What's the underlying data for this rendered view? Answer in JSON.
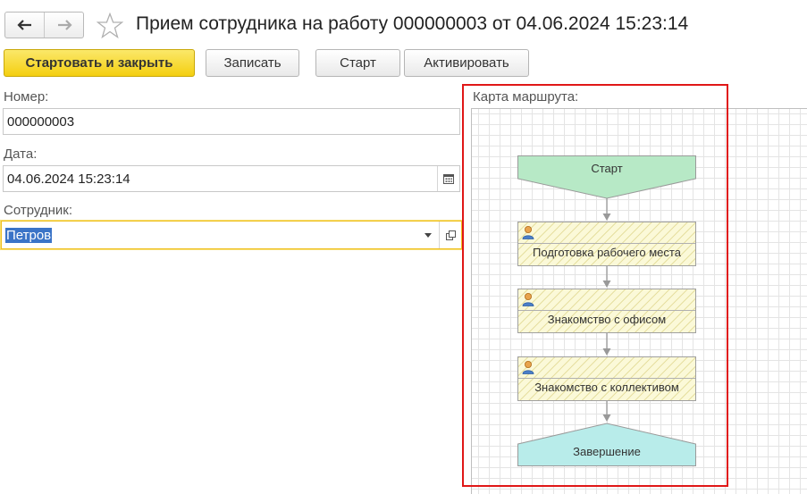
{
  "window": {
    "title": "Прием сотрудника на работу 000000003 от 04.06.2024 15:23:14"
  },
  "toolbar": {
    "start_close_label": "Стартовать и закрыть",
    "save_label": "Записать",
    "start_label": "Старт",
    "activate_label": "Активировать"
  },
  "form": {
    "number_label": "Номер:",
    "number_value": "000000003",
    "date_label": "Дата:",
    "date_value": "04.06.2024 15:23:14",
    "employee_label": "Сотрудник:",
    "employee_value": "Петров"
  },
  "route_map": {
    "label": "Карта маршрута:",
    "start_label": "Старт",
    "tasks": [
      {
        "label": "Подготовка рабочего места"
      },
      {
        "label": "Знакомство с офисом"
      },
      {
        "label": "Знакомство с коллективом"
      }
    ],
    "end_label": "Завершение",
    "colors": {
      "start_fill": "#b7e9c6",
      "end_fill": "#b8ecea",
      "task_fill": "#fbf9d8",
      "highlight_frame": "#e01717"
    }
  },
  "icons": [
    "back-arrow-icon",
    "forward-arrow-icon",
    "favorite-star-icon",
    "calendar-icon",
    "dropdown-arrow-icon",
    "open-form-icon",
    "user-icon"
  ]
}
